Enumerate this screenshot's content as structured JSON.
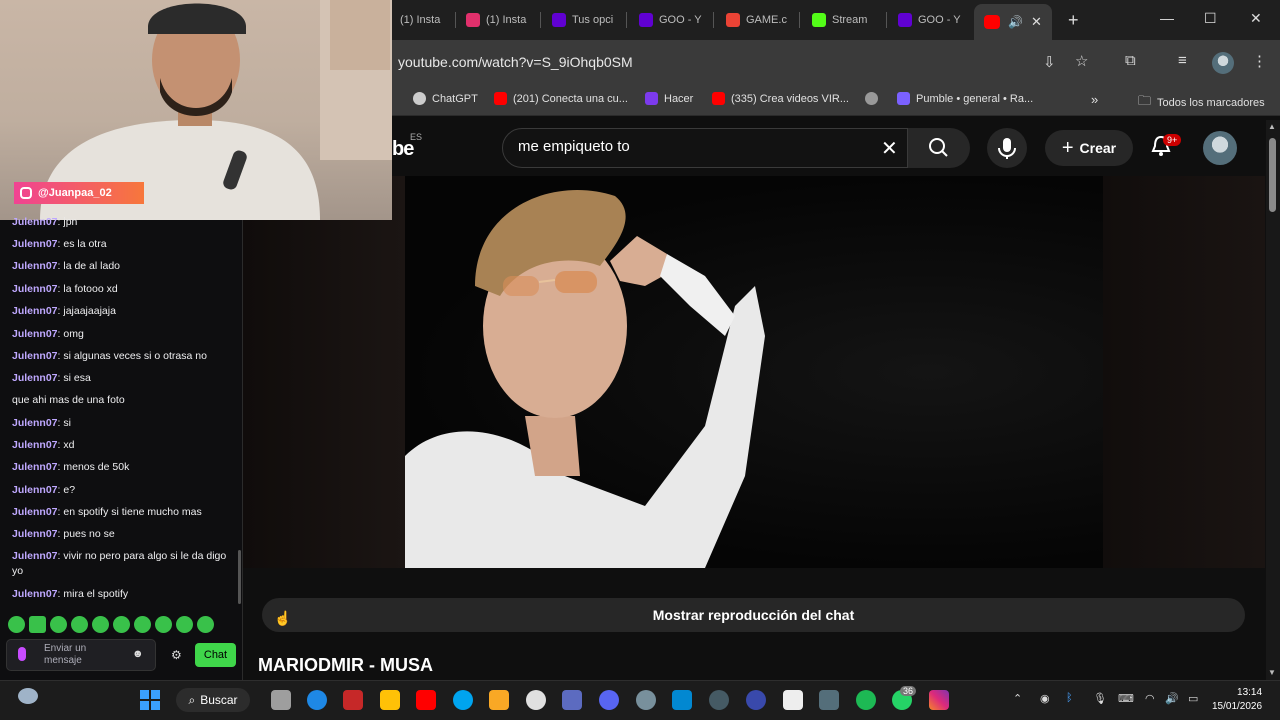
{
  "browser": {
    "tabs": [
      {
        "label": "(1) Insta",
        "color": "#e1306c"
      },
      {
        "label": "(1) Insta",
        "color": "#e1306c"
      },
      {
        "label": "Tus opci",
        "color": "#6001d2"
      },
      {
        "label": "GOO - Y",
        "color": "#6001d2"
      },
      {
        "label": "GAME.c",
        "color": "#ea4335"
      },
      {
        "label": "Stream",
        "color": "#53fc18"
      },
      {
        "label": "GOO - Y",
        "color": "#6001d2"
      }
    ],
    "new_tab": "+",
    "url": "youtube.com/watch?v=S_9iOhqb0SM",
    "bookmarks": [
      {
        "label": "ChatGPT",
        "color": "#cccccc"
      },
      {
        "label": "(201) Conecta una cu...",
        "color": "#ff0000"
      },
      {
        "label": "Hacer",
        "color": "#7c3aed"
      },
      {
        "label": "(335) Crea videos VIR...",
        "color": "#ff0000"
      },
      {
        "label": "",
        "color": "#999999"
      },
      {
        "label": "Pumble • general • Ra...",
        "color": "#7b61ff"
      }
    ],
    "all_bookmarks": "Todos los marcadores"
  },
  "youtube": {
    "region": "ES",
    "search_value": "me empiqueto to",
    "create_label": "Crear",
    "notif_count": "9+",
    "chat_replay_label": "Mostrar reproducción del chat",
    "video_title": "MARIODMIR - MUSA"
  },
  "stream": {
    "ig_handle": "@Juanpaa_02",
    "chat": [
      {
        "user": "Julenn07",
        "text": "jpn"
      },
      {
        "user": "Julenn07",
        "text": "es la otra"
      },
      {
        "user": "Julenn07",
        "text": "la de al lado"
      },
      {
        "user": "Julenn07",
        "text": "la fotooo xd"
      },
      {
        "user": "Julenn07",
        "text": "jajaajaajaja"
      },
      {
        "user": "Julenn07",
        "text": "omg"
      },
      {
        "user": "Julenn07",
        "text": "si algunas veces si o otrasa no"
      },
      {
        "user": "Julenn07",
        "text": "si esa"
      },
      {
        "user": "",
        "text": "que ahi mas de una foto"
      },
      {
        "user": "Julenn07",
        "text": "si"
      },
      {
        "user": "Julenn07",
        "text": "xd"
      },
      {
        "user": "Julenn07",
        "text": "menos de 50k"
      },
      {
        "user": "Julenn07",
        "text": "e?"
      },
      {
        "user": "Julenn07",
        "text": "en spotify si tiene mucho mas"
      },
      {
        "user": "Julenn07",
        "text": "pues no se"
      },
      {
        "user": "Julenn07",
        "text": "vivir no pero para algo si le da digo yo"
      },
      {
        "user": "Julenn07",
        "text": "mira el spotify"
      }
    ],
    "input_placeholder": "Enviar un mensaje",
    "chat_button": "Chat"
  },
  "taskbar": {
    "search_label": "Buscar",
    "whatsapp_badge": "36",
    "time": "13:14",
    "date": "15/01/2026"
  }
}
